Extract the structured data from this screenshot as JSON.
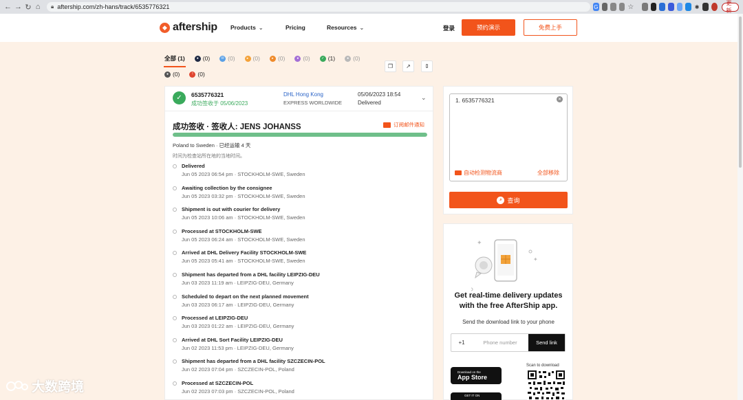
{
  "browser": {
    "url": "aftership.com/zh-hans/track/6535776321",
    "update_label": "更新"
  },
  "header": {
    "logo_text": "aftership",
    "menu": [
      {
        "label": "Products",
        "has_dropdown": true
      },
      {
        "label": "Pricing",
        "has_dropdown": false
      },
      {
        "label": "Resources",
        "has_dropdown": true
      }
    ],
    "login": "登录",
    "demo_button": "预约演示",
    "free_button": "免费上手"
  },
  "filters": {
    "row1": [
      {
        "label": "全部 (1)",
        "color": "",
        "active": true
      },
      {
        "label": "(0)",
        "color": "#1f2a44",
        "dark": true
      },
      {
        "label": "(0)",
        "color": "#5aa0e6"
      },
      {
        "label": "(0)",
        "color": "#f4a23a"
      },
      {
        "label": "(0)",
        "color": "#ef8a2a"
      },
      {
        "label": "(0)",
        "color": "#a46fd6"
      },
      {
        "label": "(1)",
        "color": "#3aaa5c"
      },
      {
        "label": "(0)",
        "color": "#b9b9b9"
      }
    ],
    "row2": [
      {
        "label": "(0)",
        "color": "#555555",
        "dark": true
      },
      {
        "label": "(0)",
        "color": "#e0452f",
        "dark": true
      }
    ]
  },
  "shipment": {
    "tracking_number": "6535776321",
    "status_text": "成功签收于 05/06/2023",
    "courier": "DHL Hong Kong",
    "service": "EXPRESS WORLDWIDE",
    "date": "05/06/2023 18:54",
    "state": "Delivered",
    "title": "成功签收 · 签收人: JENS JOHANSS",
    "subscribe_label": "订阅邮件通知",
    "progress": 1.0,
    "route": "Poland to Sweden · 已经运输 4 天",
    "timezone_note": "时间为检查站所在地的当地时间。",
    "events": [
      {
        "title": "Delivered",
        "meta": "Jun 05 2023 06:54 pm · STOCKHOLM-SWE, Sweden"
      },
      {
        "title": "Awaiting collection by the consignee",
        "meta": "Jun 05 2023 03:32 pm · STOCKHOLM-SWE, Sweden"
      },
      {
        "title": "Shipment is out with courier for delivery",
        "meta": "Jun 05 2023 10:06 am · STOCKHOLM-SWE, Sweden"
      },
      {
        "title": "Processed at STOCKHOLM-SWE",
        "meta": "Jun 05 2023 06:24 am · STOCKHOLM-SWE, Sweden"
      },
      {
        "title": "Arrived at DHL Delivery Facility STOCKHOLM-SWE",
        "meta": "Jun 05 2023 05:41 am · STOCKHOLM-SWE, Sweden"
      },
      {
        "title": "Shipment has departed from a DHL facility LEIPZIG-DEU",
        "meta": "Jun 03 2023 11:19 am · LEIPZIG-DEU, Germany"
      },
      {
        "title": "Scheduled to depart on the next planned movement",
        "meta": "Jun 03 2023 06:17 am · LEIPZIG-DEU, Germany"
      },
      {
        "title": "Processed at LEIPZIG-DEU",
        "meta": "Jun 03 2023 01:22 am · LEIPZIG-DEU, Germany"
      },
      {
        "title": "Arrived at DHL Sort Facility LEIPZIG-DEU",
        "meta": "Jun 02 2023 11:53 pm · LEIPZIG-DEU, Germany"
      },
      {
        "title": "Shipment has departed from a DHL facility SZCZECIN-POL",
        "meta": "Jun 02 2023 07:04 pm · SZCZECIN-POL, Poland"
      },
      {
        "title": "Processed at SZCZECIN-POL",
        "meta": "Jun 02 2023 07:03 pm · SZCZECIN-POL, Poland"
      }
    ]
  },
  "search_panel": {
    "input_line": "1. 6535776321",
    "auto_detect": "自动检测物流商",
    "remove_all": "全部移除",
    "query_button": "查询"
  },
  "app_panel": {
    "title": "Get real-time delivery updates with the free AfterShip app.",
    "subtitle": "Send the download link to your phone",
    "country_code": "+1",
    "phone_placeholder": "Phone number",
    "send_button": "Send link",
    "appstore_small": "Download on the",
    "appstore_big": "App Store",
    "googleplay_small": "GET IT ON",
    "scan_label": "Scan to download"
  },
  "watermark": "大数跨境",
  "colors": {
    "brand": "#f2541b",
    "success": "#3aaa5c",
    "background": "#fdf1e6"
  }
}
